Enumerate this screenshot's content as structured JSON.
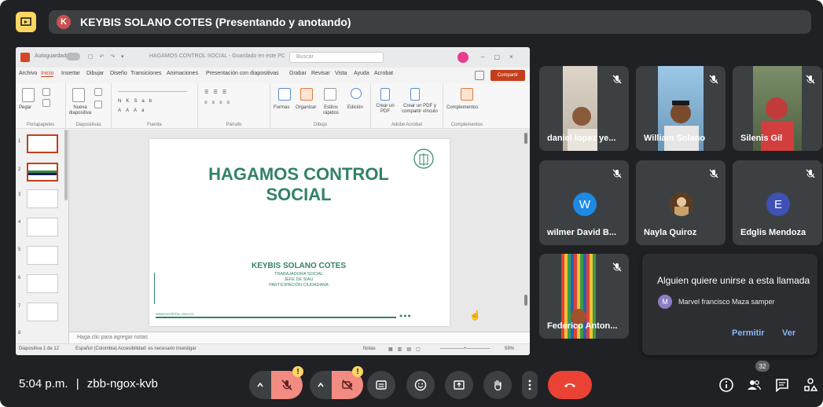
{
  "presenter": {
    "initial": "K",
    "title": "KEYBIS SOLANO COTES (Presentando y anotando)"
  },
  "powerpoint": {
    "autosave": "Autoguardado",
    "filename": "HAGAMOS CONTROL SOCIAL - Guardado en este PC",
    "search_placeholder": "Buscar",
    "menu": [
      "Archivo",
      "Inicio",
      "Insertar",
      "Dibujar",
      "Diseño",
      "Transiciones",
      "Animaciones",
      "Presentación con diapositivas",
      "Grabar",
      "Revisar",
      "Vista",
      "Ayuda",
      "Acrobat"
    ],
    "share_label": "Compartir",
    "ribbon_groups": [
      "Portapapeles",
      "Diapositivas",
      "Fuente",
      "Párrafo",
      "Dibujo",
      "Adobe Acrobat",
      "Complementos"
    ],
    "ribbon_items": {
      "paste": "Pegar",
      "new_slide": "Nueva diapositiva",
      "shapes": "Formas",
      "arrange": "Organizar",
      "quick_styles": "Estilos rápidos",
      "editing": "Edición",
      "create_pdf": "Crear un PDF",
      "create_share": "Crear un PDF y compartir vínculo",
      "addins": "Complementos"
    },
    "slide": {
      "title": "HAGAMOS CONTROL SOCIAL",
      "name": "KEYBIS SOLANO COTES",
      "sub1": "TRABAJADORA SOCIAL",
      "sub2": "JEFE DE SIAU",
      "sub3": "PARTICIPACIÓN CIUDADANA",
      "footer_text": "WWW.HOSPITAL.GOV.CO"
    },
    "notes_placeholder": "Haga clic para agregar notas",
    "status": {
      "slide_info": "Diapositiva 1 de 12",
      "language": "Español (Colombia)",
      "accessibility": "Accesibilidad: es necesario investigar",
      "notes": "Notas",
      "zoom": "59%"
    },
    "thumb_numbers": [
      "1",
      "2",
      "3",
      "4",
      "5",
      "6",
      "7",
      "8"
    ]
  },
  "participants": [
    {
      "name": "daniel lopez ye...",
      "mic": "off"
    },
    {
      "name": "William Solano",
      "mic": "off"
    },
    {
      "name": "Silenis Gil",
      "mic": "off"
    },
    {
      "name": "wilmer David B...",
      "initial": "W",
      "avatar_color": "#1e88e5",
      "mic": "off"
    },
    {
      "name": "Nayla Quiroz",
      "mic": "off"
    },
    {
      "name": "Edglis Mendoza",
      "initial": "E",
      "avatar_color": "#3f51b5",
      "mic": "off"
    },
    {
      "name": "Federico Anton...",
      "mic": "off"
    }
  ],
  "join_request": {
    "title": "Alguien quiere unirse a esta llamada",
    "initial": "M",
    "name": "Marvel francisco Maza samper",
    "admit_label": "Permitir",
    "view_label": "Ver"
  },
  "bottom": {
    "time": "5:04 p.m.",
    "separator": "|",
    "meeting_code": "zbb-ngox-kvb",
    "warning_mark": "!",
    "people_count": "32"
  },
  "colors": {
    "background": "#202124",
    "tile": "#3c4043",
    "muted_button": "#f28b82",
    "hangup": "#ea4335",
    "accent_link": "#8ab4f8",
    "slide_green": "#31826a",
    "ppt_orange": "#c43e1c"
  }
}
